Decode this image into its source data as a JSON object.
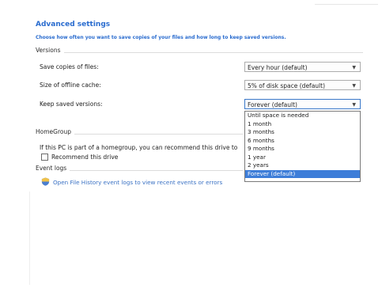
{
  "header": {
    "title": "Advanced settings",
    "subtitle": "Choose how often you want to save copies of your files and how long to keep saved versions."
  },
  "versions": {
    "group_label": "Versions",
    "save_copies_label": "Save copies of files:",
    "save_copies_value": "Every hour (default)",
    "offline_cache_label": "Size of offline cache:",
    "offline_cache_value": "5% of disk space (default)",
    "keep_versions_label": "Keep saved versions:",
    "keep_versions_value": "Forever (default)",
    "keep_versions_options": [
      "Until space is needed",
      "1 month",
      "3 months",
      "6 months",
      "9 months",
      "1 year",
      "2 years",
      "Forever (default)"
    ],
    "selected_option_index": 7
  },
  "homegroup": {
    "group_label": "HomeGroup",
    "description": "If this PC is part of a homegroup, you can recommend this drive to",
    "checkbox_label": "Recommend this drive",
    "checked": false
  },
  "event_logs": {
    "group_label": "Event logs",
    "link_text": "Open File History event logs to view recent events or errors"
  },
  "icons": {
    "dropdown_arrow": "chevron-down-icon",
    "uac_shield": "shield-icon"
  },
  "colors": {
    "accent": "#2a6ccf",
    "selection": "#3d7dd8",
    "link": "#3b72c4"
  }
}
